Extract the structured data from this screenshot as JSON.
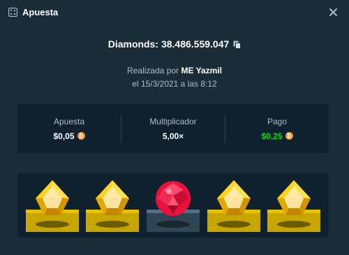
{
  "header": {
    "title": "Apuesta",
    "icon": "dice-icon",
    "close_icon": "close-icon"
  },
  "game": {
    "label": "Diamonds:",
    "id": "38.486.559.047",
    "copy_icon": "copy-icon"
  },
  "made_by": {
    "prefix": "Realizada por",
    "user": "ME Yazmil"
  },
  "date": "el 15/3/2021 a las 8:12",
  "stats": [
    {
      "label": "Apuesta",
      "value": "$0,05",
      "coin": "bitcoin-icon"
    },
    {
      "label": "Multiplicador",
      "value": "5,00×"
    },
    {
      "label": "Pago",
      "value": "$0,25",
      "coin": "bitcoin-icon",
      "color": "#00e701"
    }
  ],
  "board": {
    "gems": [
      "yellow-gem-icon",
      "yellow-gem-icon",
      "red-gem-icon",
      "yellow-gem-icon",
      "yellow-gem-icon"
    ]
  },
  "colors": {
    "background": "#1a2c38",
    "panel": "#0f212e",
    "muted_text": "#b1bad3",
    "win_green": "#00e701",
    "gold": "#c7a600",
    "ruby": "#e9113c",
    "btc": "#f7931a"
  }
}
